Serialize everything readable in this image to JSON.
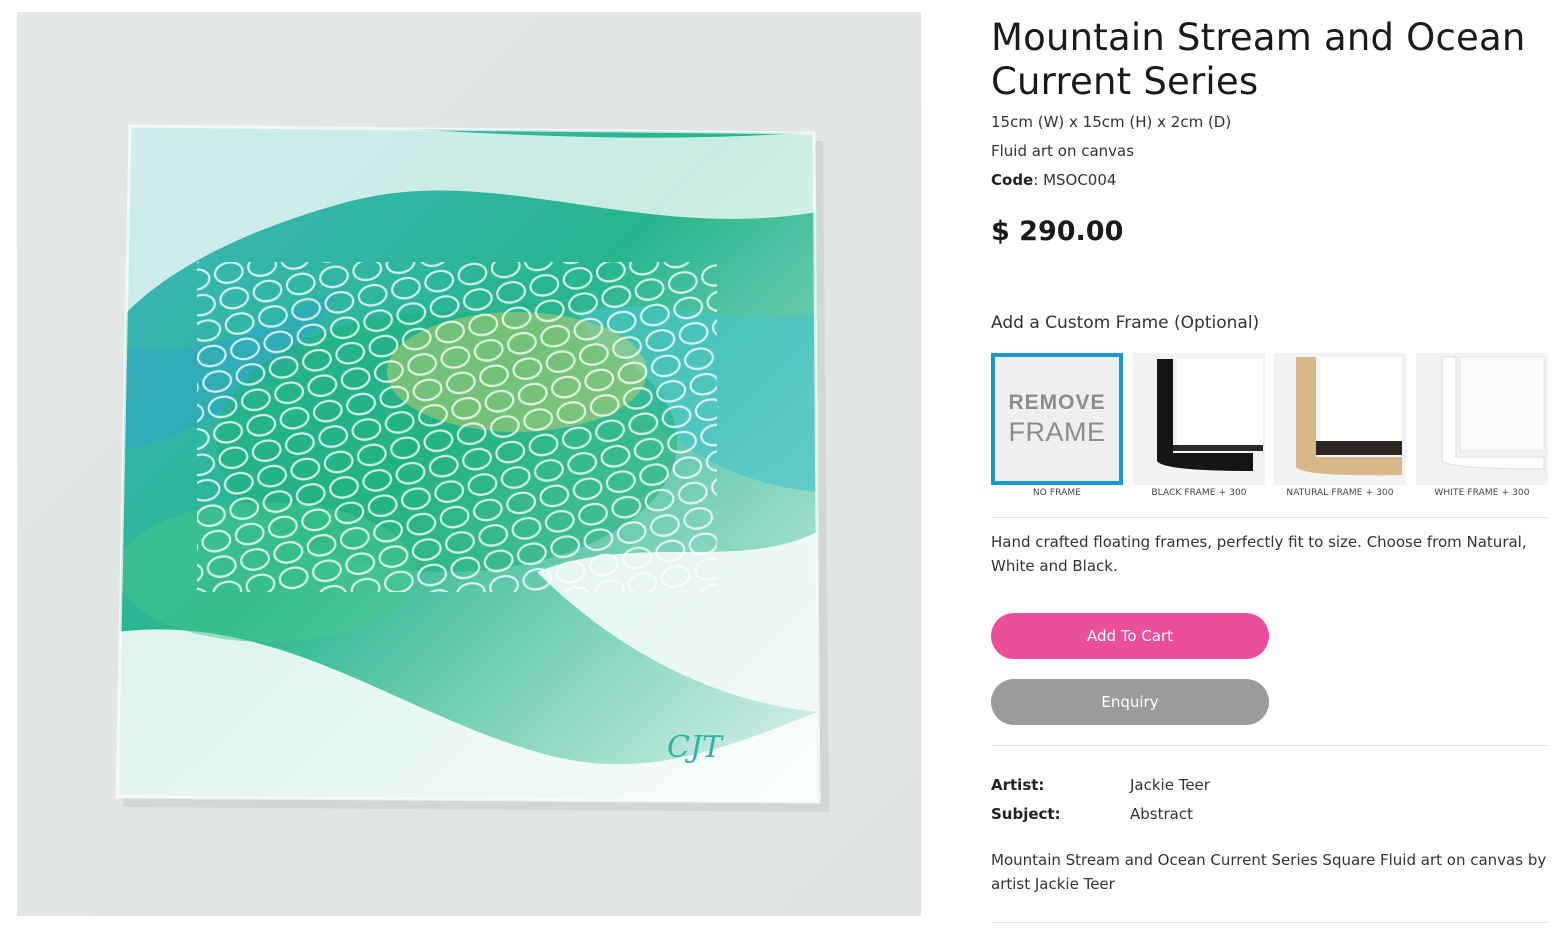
{
  "product": {
    "title": "Mountain Stream and Ocean Current Series",
    "dimensions": "15cm (W) x 15cm (H) x 2cm (D)",
    "medium": "Fluid art on canvas",
    "code_label": "Code",
    "code_value": "MSOC004",
    "price": "$ 290.00",
    "image_signature": "CJT"
  },
  "frames": {
    "heading": "Add a Custom Frame (Optional)",
    "options": [
      {
        "caption": "NO FRAME",
        "text_line1": "REMOVE",
        "text_line2": "FRAME",
        "selected": true
      },
      {
        "caption": "BLACK FRAME + 300",
        "selected": false
      },
      {
        "caption": "NATURAL FRAME + 300",
        "selected": false
      },
      {
        "caption": "WHITE FRAME + 300",
        "selected": false
      }
    ],
    "description": "Hand crafted floating frames, perfectly fit to size. Choose from Natural, White and Black."
  },
  "actions": {
    "add_to_cart": "Add To Cart",
    "enquiry": "Enquiry"
  },
  "meta": {
    "artist_label": "Artist:",
    "artist_value": "Jackie Teer",
    "subject_label": "Subject:",
    "subject_value": "Abstract"
  },
  "long_description": "Mountain Stream and Ocean Current Series Square Fluid art on canvas by artist Jackie Teer",
  "colors": {
    "selected_border": "#1a98c8",
    "cart_button": "#ec4f9a",
    "enquiry_button": "#9b9b9b"
  }
}
